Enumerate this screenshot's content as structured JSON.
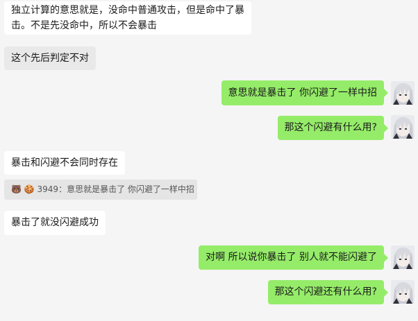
{
  "messages": [
    {
      "side": "left",
      "lines": [
        "独立计算的意思就是，没命中普通攻击，但是命中了暴",
        "击。不是先没命中，所以不会暴击"
      ]
    },
    {
      "side": "left",
      "text": "这个先后判定不对"
    },
    {
      "side": "right",
      "text": "意思就是暴击了 你闪避了一样中招"
    },
    {
      "side": "right",
      "text": "那这个闪避有什么用?"
    },
    {
      "side": "left",
      "text": "暴击和闪避不会同时存在"
    },
    {
      "quote": {
        "emoji": "🐻 🍪",
        "text": "3949：意思就是暴击了 你闪避了一样中招"
      }
    },
    {
      "side": "left",
      "text": "暴击了就没闪避成功"
    },
    {
      "side": "right",
      "text": "对啊 所以说你暴击了 别人就不能闪避了"
    },
    {
      "side": "right",
      "text": "那这个闪避还有什么用?"
    }
  ],
  "avatar_icon": "anime-avatar-icon",
  "colors": {
    "background": "#f5f5f5",
    "received_bubble": "#ffffff",
    "sent_bubble": "#95ec69",
    "quote_bg": "#e5e5e5"
  }
}
